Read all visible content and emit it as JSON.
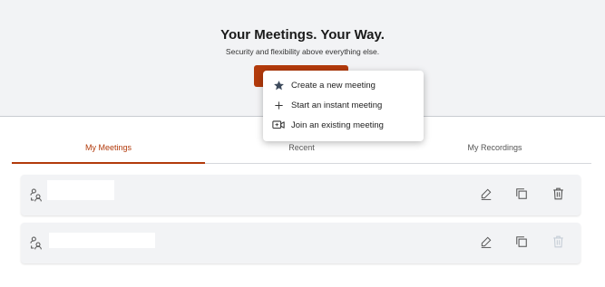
{
  "hero": {
    "title": "Your Meetings. Your Way.",
    "subtitle": "Security and flexibility above everything else.",
    "button_color": "#b23a0b"
  },
  "dropdown": {
    "items": [
      {
        "label": "Create a new meeting",
        "icon": "star-icon"
      },
      {
        "label": "Start an instant meeting",
        "icon": "plus-icon"
      },
      {
        "label": "Join an existing meeting",
        "icon": "video-join-icon"
      }
    ]
  },
  "tabs": [
    {
      "label": "My Meetings",
      "active": true
    },
    {
      "label": "Recent",
      "active": false
    },
    {
      "label": "My Recordings",
      "active": false
    }
  ],
  "meetings": [
    {
      "icon": "meeting-participants-icon",
      "actions": [
        "edit-icon",
        "copy-icon",
        "delete-icon"
      ],
      "delete_enabled": true
    },
    {
      "icon": "meeting-participants-icon",
      "actions": [
        "edit-icon",
        "copy-icon",
        "delete-icon"
      ],
      "delete_enabled": false
    }
  ],
  "colors": {
    "accent": "#b23a0b",
    "hero_bg": "#f2f3f5",
    "row_bg": "#f2f3f5",
    "icon_gray": "#555555",
    "disabled_gray": "#c5cdd6"
  }
}
